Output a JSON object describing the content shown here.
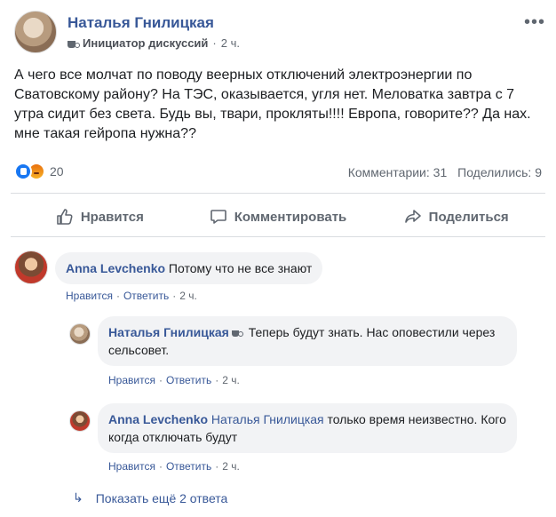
{
  "post": {
    "author": "Наталья Гнилицкая",
    "badge": "Инициатор дискуссий",
    "time": "2 ч.",
    "text": "А чего все молчат по поводу веерных отключений электроэнергии по Сватовскому району? На ТЭС, оказывается, угля нет. Меловатка завтра с 7 утра сидит без света. Будь вы, твари, прокляты!!!! Европа, говорите?? Да нах. мне такая гейропа нужна??",
    "reaction_count": "20",
    "comments_stat": "Комментарии: 31",
    "shares_stat": "Поделились: 9",
    "menu_icon": "more-icon",
    "reactions": [
      "like",
      "angry"
    ]
  },
  "actions": {
    "like": "Нравится",
    "comment": "Комментировать",
    "share": "Поделиться"
  },
  "comments": [
    {
      "author": "Anna Levchenko",
      "text": "Потому что не все знают",
      "like": "Нравится",
      "reply": "Ответить",
      "time": "2 ч."
    }
  ],
  "replies": [
    {
      "author": "Наталья Гнилицкая",
      "text": "Теперь будут знать. Нас оповестили через сельсовет.",
      "like": "Нравится",
      "reply": "Ответить",
      "time": "2 ч."
    },
    {
      "author": "Anna Levchenko",
      "mention": "Наталья Гнилицкая",
      "text": "только время неизвестно. Кого когда отключать будут",
      "like": "Нравится",
      "reply": "Ответить",
      "time": "2 ч."
    }
  ],
  "more_replies": "Показать ещё 2 ответа",
  "colors": {
    "link": "#385898",
    "secondary": "#606770",
    "bubble": "#f2f3f5",
    "like_blue": "#1877f2"
  }
}
